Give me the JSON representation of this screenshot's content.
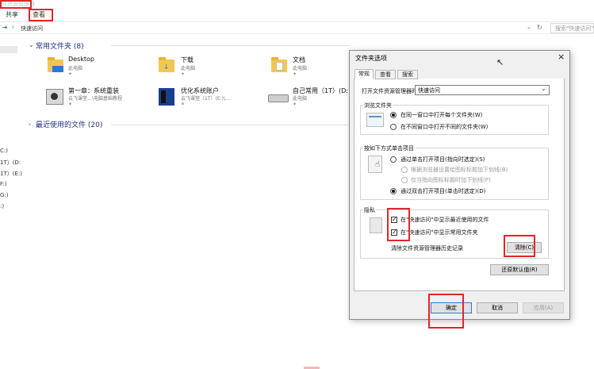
{
  "window": {
    "title": "件资源管理器"
  },
  "ribbon": {
    "tabs": [
      "共享",
      "查看"
    ]
  },
  "address": {
    "path": "快速访问",
    "search_placeholder": "搜索\"快速访问\""
  },
  "sidebar": {
    "items": [
      "C:)",
      "1T）(D:",
      "1T）(E:)",
      "F:)",
      "G:)",
      ":)"
    ]
  },
  "quick_access": {
    "header": "常用文件夹 (8)",
    "items": [
      {
        "name": "Desktop",
        "sub": "此电脑"
      },
      {
        "name": "下载",
        "sub": "此电脑"
      },
      {
        "name": "文档",
        "sub": "此电脑"
      },
      {
        "name": "第一章：系统重装",
        "sub": "云飞课堂…\\电脑基础教程"
      },
      {
        "name": "优化系统账户",
        "sub": "云飞课堂（1T）(E:)\\..."
      },
      {
        "name": "自己常用（1T）(D:",
        "sub": "此电脑"
      }
    ]
  },
  "recent": {
    "header": "最近使用的文件 (20)"
  },
  "dialog": {
    "title": "文件夹选项",
    "close": "×",
    "tabs": [
      "常规",
      "查看",
      "搜索"
    ],
    "open_label": "打开文件资源管理器时打开:",
    "open_value": "快速访问",
    "browse_group": "浏览文件夹",
    "browse_opt1": "在同一窗口中打开每个文件夹(W)",
    "browse_opt2": "在不同窗口中打开不同的文件夹(W)",
    "click_group": "按如下方式单击项目",
    "click_opt1": "通过单击打开项目(指向时选定)(S)",
    "click_sub1": "根据浏览器设置给图标标题加下划线(B)",
    "click_sub2": "仅当指向图标标题时加下划线(P)",
    "click_opt2": "通过双击打开项目(单击时选定)(D)",
    "privacy_group": "隐私",
    "privacy_chk1": "在\"快速访问\"中显示最近使用的文件",
    "privacy_chk2": "在\"快速访问\"中显示常用文件夹",
    "clear_label": "清除文件资源管理器历史记录",
    "clear_btn": "清除(C)",
    "restore_btn": "还原默认值(R)",
    "ok_btn": "确定",
    "cancel_btn": "取消",
    "apply_btn": "应用(A)"
  },
  "colors": {
    "highlight": "#e0262b",
    "folder": "#f3c74f",
    "group_header": "#1e3287"
  }
}
